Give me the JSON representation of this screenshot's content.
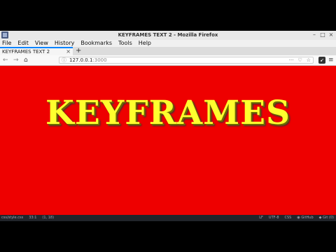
{
  "window": {
    "title": "KEYFRAMES TEXT 2 - Mozilla Firefox"
  },
  "menubar": {
    "items": [
      "File",
      "Edit",
      "View",
      "History",
      "Bookmarks",
      "Tools",
      "Help"
    ]
  },
  "tabs": {
    "active_label": "KEYFRAMES TEXT 2",
    "close_glyph": "×",
    "new_tab_glyph": "+"
  },
  "navbar": {
    "back_glyph": "←",
    "forward_glyph": "→",
    "home_glyph": "⌂",
    "url_host": "127.0.0.1",
    "url_port": ":3000",
    "page_actions_glyph": "···",
    "menu_glyph": "≡"
  },
  "page": {
    "heading": "KEYFRAMES",
    "background": "#ee0000",
    "text_color": "#ffff2e"
  },
  "statusbar": {
    "file": "css/style.css",
    "cursor": "33:1",
    "selection": "(1, 18)",
    "line_ending": "LF",
    "encoding": "UTF-8",
    "grammar": "CSS",
    "github": "GitHub",
    "git": "Git (0)"
  }
}
